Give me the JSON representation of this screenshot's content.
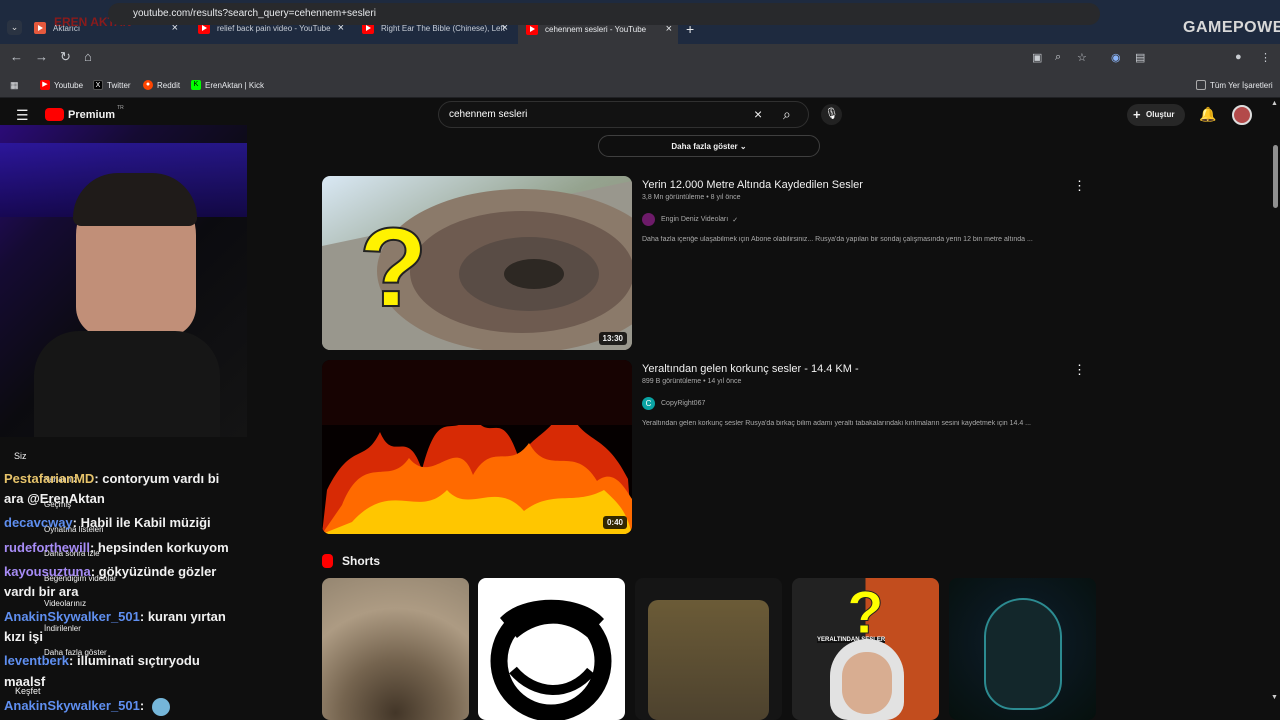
{
  "tabs": [
    {
      "label": "Aktarıcı",
      "close": "×"
    },
    {
      "label": "relief back pain video - YouTube",
      "close": "×"
    },
    {
      "label": "Right Ear The Bible (Chinese), Left",
      "close": "×"
    },
    {
      "label": "cehennem sesleri - YouTube",
      "close": "×"
    }
  ],
  "tab_add": "+",
  "address": "youtube.com/results?search_query=cehennem+sesleri",
  "bookmarks": [
    "Youtube",
    "Twitter",
    "Reddit",
    "ErenAktan | Kick"
  ],
  "bookmarks_right": "Tüm Yer İşaretleri",
  "watermark": "GAMEPOWER",
  "overlay_logo": "EREN AKTAN",
  "youtube": {
    "brand": "Premium",
    "country": "TR",
    "search_value": "cehennem sesleri",
    "create": "Oluştur",
    "more_results": "Daha fazla göster"
  },
  "videos": [
    {
      "title": "Yerin 12.000 Metre Altında Kaydedilen Sesler",
      "views": "3,8 Mn görüntüleme",
      "age": "8 yıl önce",
      "channel": "Engin Deniz Videoları",
      "description": "Daha fazla içeriğe ulaşabilmek için Abone olabilirsiniz... Rusya'da yapılan bir sondaj çalışmasında yerin 12 bin metre altında ...",
      "duration": "13:30"
    },
    {
      "title": "Yeraltından gelen korkunç sesler - 14.4 KM -",
      "views": "899 B görüntüleme",
      "age": "14 yıl önce",
      "channel": "CopyRight067",
      "channel_initial": "C",
      "description": "Yeraltından gelen korkunç sesler Rusya'da birkaç bilim adamı yeraltı tabakalarındaki kırılmaların sesini kaydetmek için 14.4 ...",
      "duration": "0:40"
    }
  ],
  "shorts": {
    "title": "Shorts",
    "overlay_label": "YERALTINDAN SESLER"
  },
  "sidebar": {
    "section": "Siz",
    "items": [
      "Kanalınız",
      "Geçmiş",
      "Oynatma listeleri",
      "Daha sonra izle",
      "Beğendiğim videolar",
      "Videolarınız",
      "İndirilenler",
      "Daha fazla göster"
    ],
    "footer": "Keşfet"
  },
  "chat": [
    {
      "user": "PestafarianMD",
      "text": ": contoryum vardı bi"
    },
    {
      "user": "",
      "text": "ara @ErenAktan"
    },
    {
      "user": "decavcway",
      "text": ": Habil ile Kabil müziği"
    },
    {
      "user": "rudeforthewill",
      "text": ": hepsinden korkuyom"
    },
    {
      "user": "kayousuztuna",
      "text": ": gökyüzünde gözler"
    },
    {
      "user": "",
      "text": "vardı bir ara"
    },
    {
      "user": "AnakinSkywalker_501",
      "text": ": kuranı yırtan"
    },
    {
      "user": "",
      "text": "kızı işi"
    },
    {
      "user": "leventberk",
      "text": ": illuminati sıçtıryodu"
    },
    {
      "user": "",
      "text": "maalsf"
    },
    {
      "user": "AnakinSkywalker_501",
      "text": ":"
    }
  ],
  "colors": {
    "bg": "#0f0f0f",
    "chrome": "#35363a",
    "accent": "#ff0000"
  }
}
